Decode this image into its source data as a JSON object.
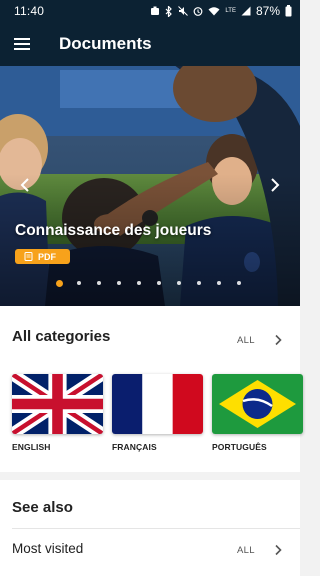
{
  "status_bar": {
    "time": "11:40",
    "network": "LTE",
    "battery": "87%"
  },
  "app_bar": {
    "title": "Documents",
    "menu_icon": "hamburger-menu-icon"
  },
  "hero": {
    "title": "Connaissance des joueurs",
    "badge": "PDF",
    "slide_count": 10,
    "active_slide": 1
  },
  "categories": {
    "title": "All categories",
    "all_label": "ALL",
    "items": [
      {
        "label": "ENGLISH",
        "flag": "uk-flag"
      },
      {
        "label": "FRANÇAIS",
        "flag": "france-flag"
      },
      {
        "label": "PORTUGUÊS",
        "flag": "brazil-flag"
      }
    ]
  },
  "see_also": {
    "title": "See also",
    "most_visited": "Most visited",
    "all_label": "ALL"
  },
  "colors": {
    "app_bar": "#0c2233",
    "accent": "#f7a21b"
  }
}
